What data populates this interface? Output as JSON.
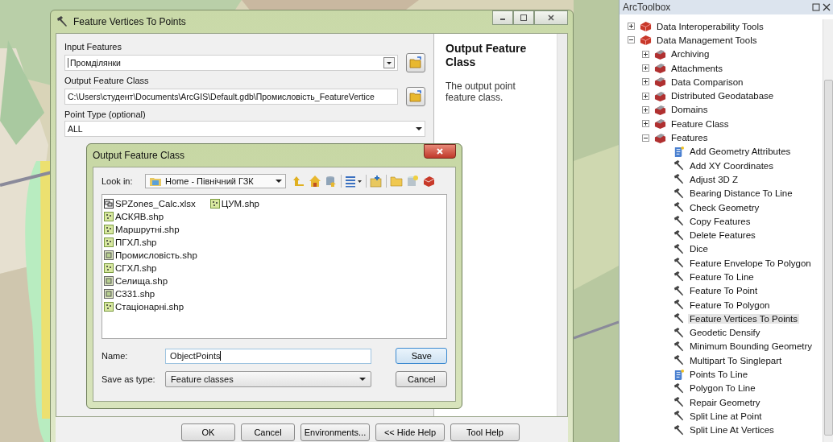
{
  "tool_dialog": {
    "title": "Feature Vertices To Points",
    "params": [
      {
        "label": "Input Features",
        "value": "Промділянки",
        "kind": "dropdown",
        "browse": true
      },
      {
        "label": "Output Feature Class",
        "value": "C:\\Users\\студент\\Documents\\ArcGIS\\Default.gdb\\Промисловість_FeatureVertice",
        "kind": "text",
        "browse": true
      },
      {
        "label": "Point Type (optional)",
        "value": "ALL",
        "kind": "select",
        "browse": false
      }
    ],
    "help": {
      "heading": "Output Feature Class",
      "text": "The output point feature class."
    },
    "buttons": [
      "OK",
      "Cancel",
      "Environments...",
      "<< Hide Help",
      "Tool Help"
    ]
  },
  "output_dialog": {
    "title": "Output Feature Class",
    "look_in_label": "Look in:",
    "look_in": "Home - Північний ГЗК",
    "files": [
      {
        "name": "SPZones_Calc.xlsx",
        "kind": "table"
      },
      {
        "name": "АСКЯВ.shp",
        "kind": "point"
      },
      {
        "name": "Маршрутні.shp",
        "kind": "point"
      },
      {
        "name": "ПГХЛ.shp",
        "kind": "point"
      },
      {
        "name": "Промисловість.shp",
        "kind": "polygon"
      },
      {
        "name": "СГХЛ.shp",
        "kind": "point"
      },
      {
        "name": "Селища.shp",
        "kind": "polygon"
      },
      {
        "name": "С331.shp",
        "kind": "polygon"
      },
      {
        "name": "Стаціонарні.shp",
        "kind": "point"
      },
      {
        "name": "ЦУМ.shp",
        "kind": "point"
      }
    ],
    "name_label": "Name:",
    "name_value": "ObjectPoints",
    "type_label": "Save as type:",
    "type_value": "Feature classes",
    "buttons": [
      "Save",
      "Cancel"
    ]
  },
  "toolbox": {
    "title": "ArcToolbox",
    "items": [
      {
        "label": "Data Interoperability Tools",
        "kind": "toolbox",
        "expanded": false,
        "selected": false
      },
      {
        "label": "Data Management Tools",
        "kind": "toolbox",
        "expanded": true,
        "selected": false,
        "children": [
          {
            "label": "Archiving",
            "kind": "toolset",
            "expanded": false,
            "selected": false
          },
          {
            "label": "Attachments",
            "kind": "toolset",
            "expanded": false,
            "selected": false
          },
          {
            "label": "Data Comparison",
            "kind": "toolset",
            "expanded": false,
            "selected": false
          },
          {
            "label": "Distributed Geodatabase",
            "kind": "toolset",
            "expanded": false,
            "selected": false
          },
          {
            "label": "Domains",
            "kind": "toolset",
            "expanded": false,
            "selected": false
          },
          {
            "label": "Feature Class",
            "kind": "toolset",
            "expanded": false,
            "selected": false
          },
          {
            "label": "Features",
            "kind": "toolset",
            "expanded": true,
            "selected": false,
            "children": [
              {
                "label": "Add Geometry Attributes",
                "kind": "script",
                "selected": false
              },
              {
                "label": "Add XY Coordinates",
                "kind": "tool",
                "selected": false
              },
              {
                "label": "Adjust 3D Z",
                "kind": "tool",
                "selected": false
              },
              {
                "label": "Bearing Distance To Line",
                "kind": "tool",
                "selected": false
              },
              {
                "label": "Check Geometry",
                "kind": "tool",
                "selected": false
              },
              {
                "label": "Copy Features",
                "kind": "tool",
                "selected": false
              },
              {
                "label": "Delete Features",
                "kind": "tool",
                "selected": false
              },
              {
                "label": "Dice",
                "kind": "tool",
                "selected": false
              },
              {
                "label": "Feature Envelope To Polygon",
                "kind": "tool",
                "selected": false
              },
              {
                "label": "Feature To Line",
                "kind": "tool",
                "selected": false
              },
              {
                "label": "Feature To Point",
                "kind": "tool",
                "selected": false
              },
              {
                "label": "Feature To Polygon",
                "kind": "tool",
                "selected": false
              },
              {
                "label": "Feature Vertices To Points",
                "kind": "tool",
                "selected": true
              },
              {
                "label": "Geodetic Densify",
                "kind": "tool",
                "selected": false
              },
              {
                "label": "Minimum Bounding Geometry",
                "kind": "tool",
                "selected": false
              },
              {
                "label": "Multipart To Singlepart",
                "kind": "tool",
                "selected": false
              },
              {
                "label": "Points To Line",
                "kind": "script",
                "selected": false
              },
              {
                "label": "Polygon To Line",
                "kind": "tool",
                "selected": false
              },
              {
                "label": "Repair Geometry",
                "kind": "tool",
                "selected": false
              },
              {
                "label": "Split Line at Point",
                "kind": "tool",
                "selected": false
              },
              {
                "label": "Split Line At Vertices",
                "kind": "tool",
                "selected": false
              }
            ]
          }
        ]
      }
    ]
  }
}
